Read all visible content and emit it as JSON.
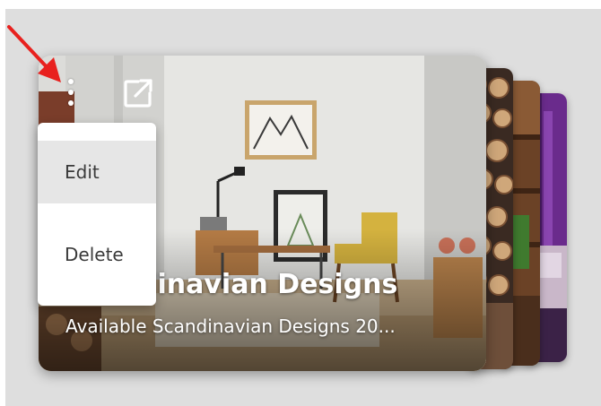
{
  "card": {
    "title": "Scandinavian Designs",
    "subtitle": "Available Scandinavian Designs 20..."
  },
  "actions": {
    "menu_icon": "kebab-vertical-icon",
    "external_icon": "open-external-icon"
  },
  "menu": {
    "items": [
      {
        "label": "Edit",
        "highlighted": true
      },
      {
        "label": "Delete",
        "highlighted": false
      }
    ]
  },
  "annotation": {
    "arrow_color": "#e8211e"
  },
  "colors": {
    "panel_bg": "#dedede",
    "menu_bg": "#ffffff",
    "menu_highlight": "#e6e6e6",
    "menu_text": "#3a3a3a"
  }
}
